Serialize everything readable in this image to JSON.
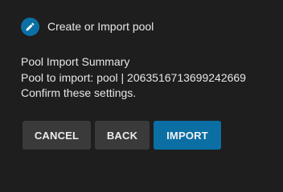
{
  "dialog": {
    "title": "Create or Import pool",
    "icon": "pencil-icon",
    "accent_color": "#0b6fa4"
  },
  "summary": {
    "heading": "Pool Import Summary",
    "pool_line": "Pool to import: pool | 2063516713699242669",
    "confirm_text": "Confirm these settings."
  },
  "buttons": {
    "cancel": "CANCEL",
    "back": "BACK",
    "import": "IMPORT"
  }
}
